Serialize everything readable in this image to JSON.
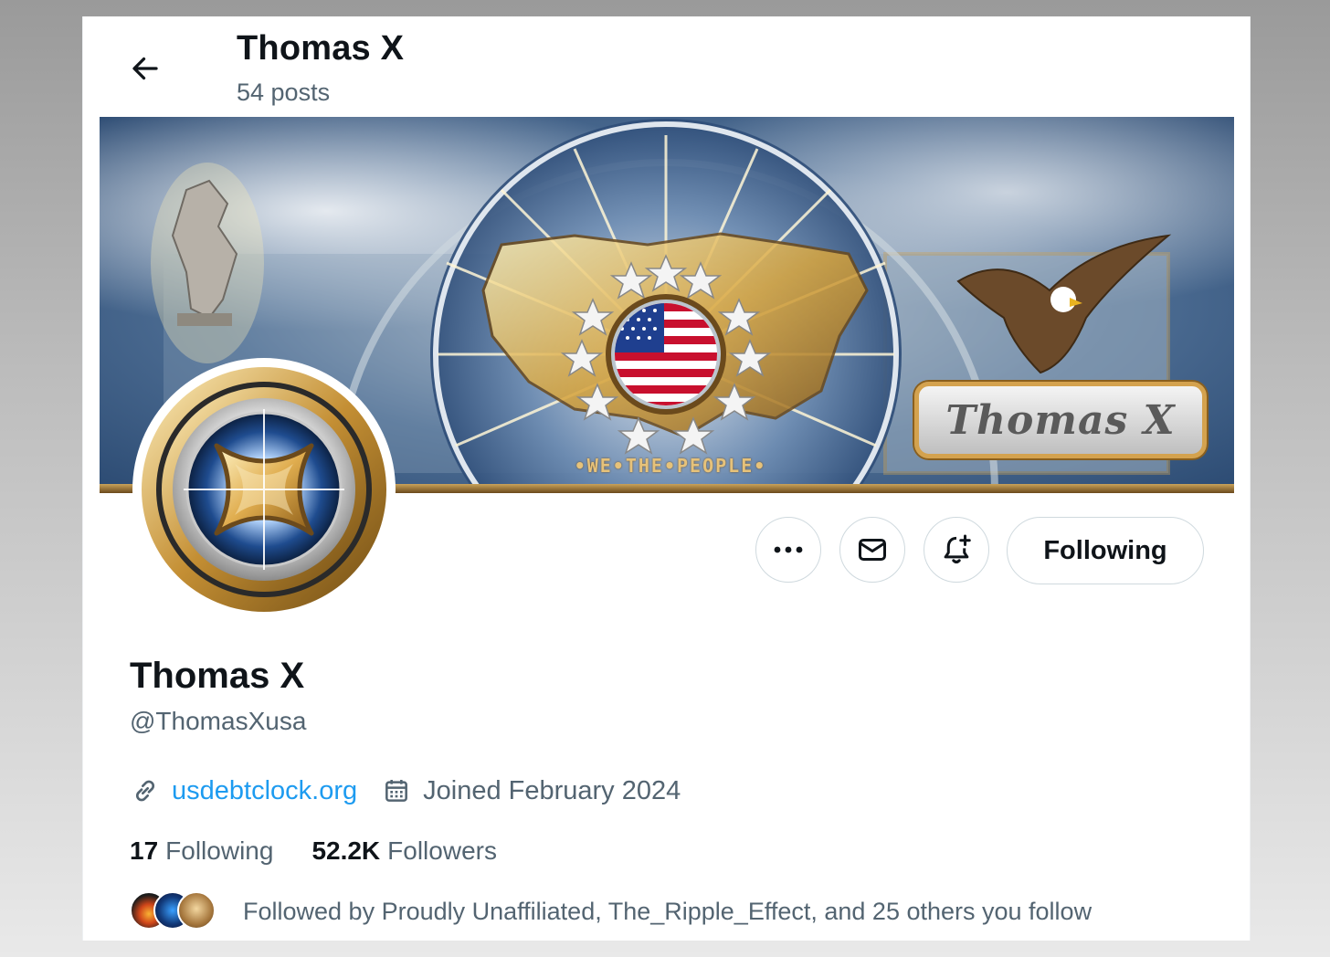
{
  "header": {
    "display_name": "Thomas X",
    "post_count": "54 posts"
  },
  "banner": {
    "label": "Thomas X",
    "motto": "•WE•THE•PEOPLE•"
  },
  "actions": {
    "following_label": "Following"
  },
  "profile": {
    "display_name": "Thomas X",
    "handle": "@ThomasXusa",
    "website": "usdebtclock.org",
    "joined": "Joined February 2024",
    "following_count": "17",
    "following_label": "Following",
    "followers_count": "52.2K",
    "followers_label": "Followers",
    "followed_by": "Followed by Proudly Unaffiliated, The_Ripple_Effect, and 25 others you follow"
  },
  "icons": {
    "back": "arrow-left-icon",
    "more": "ellipsis-icon",
    "message": "envelope-icon",
    "notify": "bell-plus-icon",
    "link": "link-icon",
    "calendar": "calendar-icon"
  },
  "colors": {
    "accent_link": "#1d9bf0",
    "secondary_text": "#536471",
    "primary_text": "#0f1419",
    "border": "#cfd9de"
  }
}
